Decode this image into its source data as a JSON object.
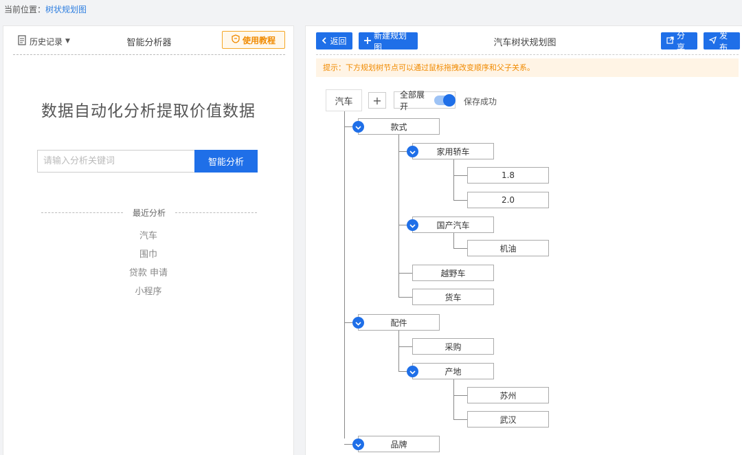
{
  "breadcrumb": {
    "prefix": "当前位置：",
    "current": "树状规划图"
  },
  "left": {
    "history_label": "历史记录",
    "title": "智能分析器",
    "tutorial_label": "使用教程",
    "hero": "数据自动化分析提取价值数据",
    "search": {
      "placeholder": "请输入分析关键词",
      "value": "",
      "button": "智能分析"
    },
    "recent_label": "最近分析",
    "recent": [
      "汽车",
      "围巾",
      "贷款 申请",
      "小程序"
    ]
  },
  "right": {
    "back_label": "返回",
    "new_label": "新建规划图",
    "title": "汽车树状规划图",
    "share_label": "分享",
    "publish_label": "发布",
    "tip": "提示：下方规划树节点可以通过鼠标拖拽改变顺序和父子关系。",
    "root": "汽车",
    "plus": "+",
    "expand_all": "全部展开",
    "save_status": "保存成功",
    "nodes": {
      "style": "款式",
      "sedan": "家用轿车",
      "v18": "1.8",
      "v20": "2.0",
      "domestic": "国产汽车",
      "oil": "机油",
      "suv": "越野车",
      "truck": "货车",
      "parts": "配件",
      "purchase": "采购",
      "origin": "产地",
      "suzhou": "苏州",
      "wuhan": "武汉",
      "brand": "品牌"
    }
  },
  "colors": {
    "accent": "#1f6fe8",
    "warning": "#f08a00",
    "tip_bg": "#fff4e5"
  }
}
